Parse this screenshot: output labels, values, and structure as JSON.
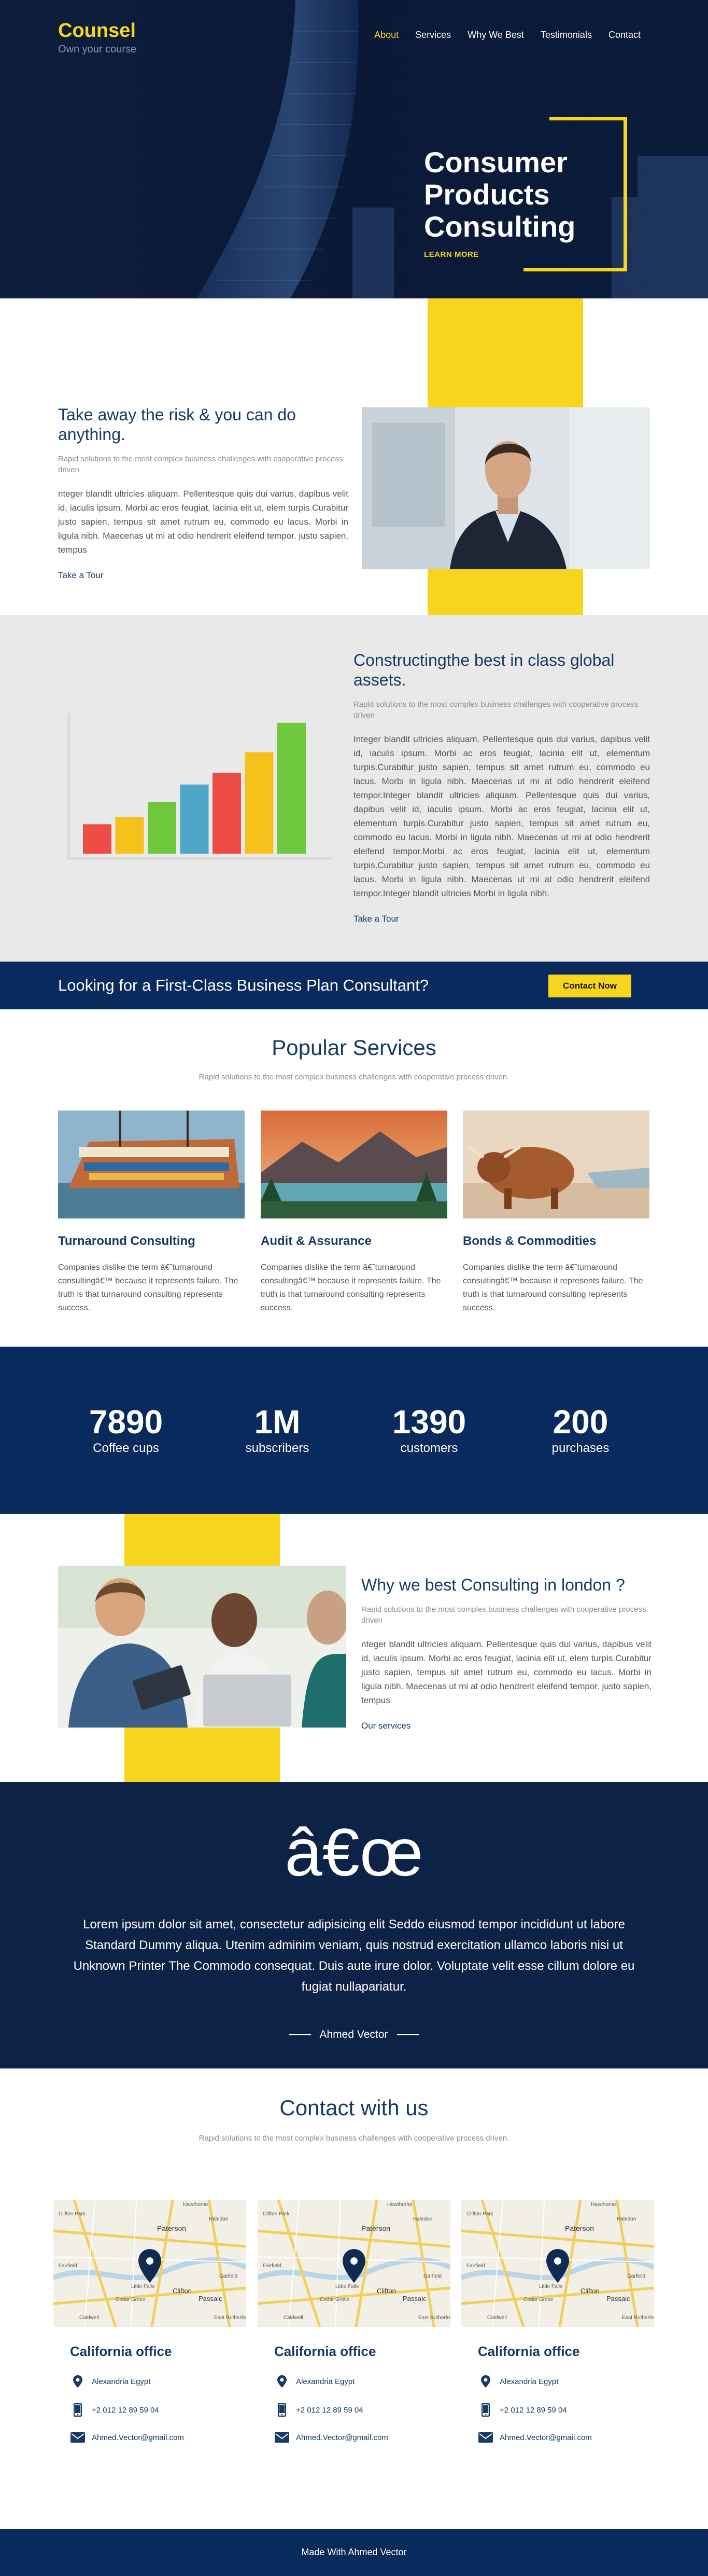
{
  "brand": {
    "name": "Counsel",
    "tagline": "Own your course"
  },
  "nav": [
    "About",
    "Services",
    "Why We Best",
    "Testimonials",
    "Contact"
  ],
  "hero": {
    "title_lines": [
      "Consumer",
      "Products",
      "Consulting"
    ],
    "button": "LEARN MORE"
  },
  "about": {
    "title": "Take away the risk & you can do anything.",
    "subtitle": "Rapid solutions to the most complex business challenges with cooperative process driven",
    "paragraph": "nteger blandit ultricies aliquam. Pellentesque quis dui varius, dapibus velit id, iaculis ipsum. Morbi ac eros feugiat, lacinia elit ut, elem turpis.Curabitur justo sapien, tempus sit amet rutrum eu, commodo eu lacus. Morbi in ligula nibh. Maecenas ut mi at odio hendrerit eleifend tempor. justo sapien, tempus",
    "link": "Take a Tour"
  },
  "about2": {
    "title": "Constructingthe best in class global assets.",
    "subtitle": "Rapid solutions to the most complex business challenges with cooperative process driven",
    "paragraph": "Integer blandit ultricies aliquam. Pellentesque quis dui varius, dapibus velit id, iaculis ipsum. Morbi ac eros feugiat, lacinia elit ut, elementum turpis.Curabitur justo sapien, tempus sit amet rutrum eu, commodo eu lacus. Morbi in ligula nibh. Maecenas ut mi at odio hendrerit eleifend tempor.Integer blandit ultricies aliquam. Pellentesque quis dui varius, dapibus velit id, iaculis ipsum. Morbi ac eros feugiat, lacinia elit ut, elementum turpis.Curabitur justo sapien, tempus sit amet rutrum eu, commodo eu lacus. Morbi in ligula nibh. Maecenas ut mi at odio hendrerit eleifend tempor.Morbi ac eros feugiat, lacinia elit ut, elementum turpis.Curabitur justo sapien, tempus sit amet rutrum eu, commodo eu lacus. Morbi in ligula nibh. Maecenas ut mi at odio hendrerit eleifend tempor.Integer blandit ultricies Morbi in ligula nibh.",
    "link": "Take a Tour",
    "bars": [
      {
        "value": 2,
        "color": "#ee4d45"
      },
      {
        "value": 2.5,
        "color": "#f6c11b"
      },
      {
        "value": 3.5,
        "color": "#6fc73d"
      },
      {
        "value": 4.7,
        "color": "#4fa6c9"
      },
      {
        "value": 5.5,
        "color": "#ee4d45"
      },
      {
        "value": 6.9,
        "color": "#f6c11b"
      },
      {
        "value": 8.9,
        "color": "#6fc73d"
      }
    ]
  },
  "cta": {
    "text": "Looking for a First-Class Business Plan Consultant?",
    "button": "Contact Now"
  },
  "services": {
    "title": "Popular Services",
    "subtitle": "Rapid solutions to the most complex business challenges with cooperative process driven.",
    "items": [
      {
        "title": "Turnaround Consulting",
        "text": "Companies dislike the term â€˜turnaround consultingâ€™ because it represents failure. The truth is that turnaround consulting represents success."
      },
      {
        "title": "Audit & Assurance",
        "text": "Companies dislike the term â€˜turnaround consultingâ€™ because it represents failure. The truth is that turnaround consulting represents success."
      },
      {
        "title": "Bonds & Commodities",
        "text": "Companies dislike the term â€˜turnaround consultingâ€™ because it represents failure. The truth is that turnaround consulting represents success."
      }
    ]
  },
  "stats": [
    {
      "value": "7890",
      "label": "Coffee cups"
    },
    {
      "value": "1M",
      "label": "subscribers"
    },
    {
      "value": "1390",
      "label": "customers"
    },
    {
      "value": "200",
      "label": "purchases"
    }
  ],
  "why": {
    "title": "Why we best Consulting in london ?",
    "subtitle": "Rapid solutions to the most complex business challenges with cooperative process driven",
    "paragraph": "nteger blandit ultricies aliquam. Pellentesque quis dui varius, dapibus velit id, iaculis ipsum. Morbi ac eros feugiat, lacinia elit ut, elem turpis.Curabitur justo sapien, tempus sit amet rutrum eu, commodo eu lacus. Morbi in ligula nibh. Maecenas ut mi at odio hendrerit eleifend tempor. justo sapien, tempus",
    "link": "Our services"
  },
  "testimonial": {
    "quote_mark": "â€œ",
    "text": "Lorem ipsum dolor sit amet, consectetur adipisicing elit Seddo eiusmod tempor incididunt ut labore Standard Dummy aliqua. Utenim adminim veniam, quis nostrud exercitation ullamco laboris nisi ut Unknown Printer The Commodo consequat. Duis aute irure dolor. Voluptate velit esse cillum dolore eu fugiat nullapariatur.",
    "author": "Ahmed Vector"
  },
  "contact": {
    "title": "Contact with us",
    "subtitle": "Rapid solutions to the most complex business challenges with cooperative process driven.",
    "map_labels": {
      "a": "Hawthorne",
      "b": "Clifton Park",
      "c": "Paterson",
      "d": "Fairfield",
      "e": "Little Falls",
      "f": "Cedar Grove",
      "g": "Clifton",
      "h": "Passaic",
      "i": "Caldwell",
      "j": "East Rutherford",
      "k": "Haledon",
      "l": "Garfield"
    },
    "offices": [
      {
        "title": "California office",
        "address": "Alexandria Egypt",
        "phone": "+2 012 12 89 59 04",
        "email": "Ahmed.Vector@gmail.com"
      },
      {
        "title": "California office",
        "address": "Alexandria Egypt",
        "phone": "+2 012 12 89 59 04",
        "email": "Ahmed.Vector@gmail.com"
      },
      {
        "title": "California office",
        "address": "Alexandria Egypt",
        "phone": "+2 012 12 89 59 04",
        "email": "Ahmed.Vector@gmail.com"
      }
    ]
  },
  "footer": {
    "text": "Made With Ahmed Vector"
  }
}
